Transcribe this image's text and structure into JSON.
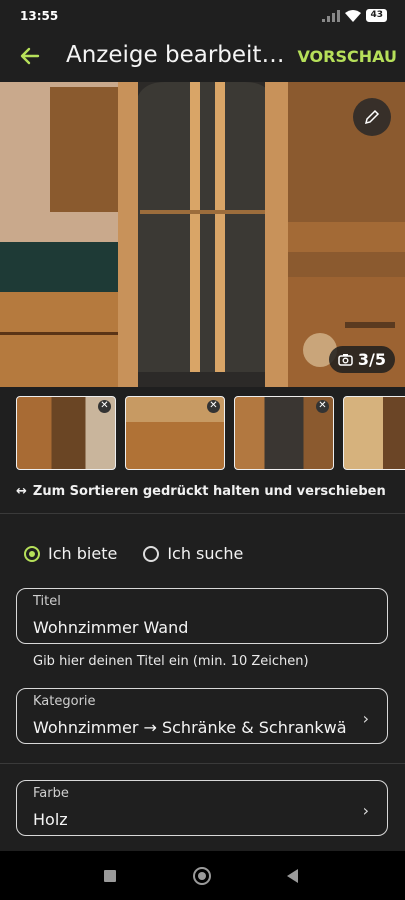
{
  "status": {
    "time": "13:55",
    "battery": "43"
  },
  "appbar": {
    "title": "Anzeige bearbeit…",
    "preview_label": "VORSCHAU"
  },
  "photo": {
    "counter": "3/5"
  },
  "thumbs": [
    {
      "name": "thumb-1"
    },
    {
      "name": "thumb-2"
    },
    {
      "name": "thumb-3"
    },
    {
      "name": "thumb-4"
    }
  ],
  "hint": {
    "icon": "↔",
    "text": "Zum Sortieren gedrückt halten und verschieben"
  },
  "offer_type": {
    "option_offer": "Ich biete",
    "option_search": "Ich suche",
    "selected": "Ich biete"
  },
  "title_field": {
    "label": "Titel",
    "value": "Wohnzimmer Wand",
    "helper": "Gib hier deinen Titel ein (min. 10 Zeichen)"
  },
  "category_field": {
    "label": "Kategorie",
    "value": "Wohnzimmer → Schränke & Schrankwä"
  },
  "color_field": {
    "label": "Farbe",
    "value": "Holz"
  },
  "colors": {
    "accent": "#b6e05a",
    "background": "#1f1f1f"
  }
}
